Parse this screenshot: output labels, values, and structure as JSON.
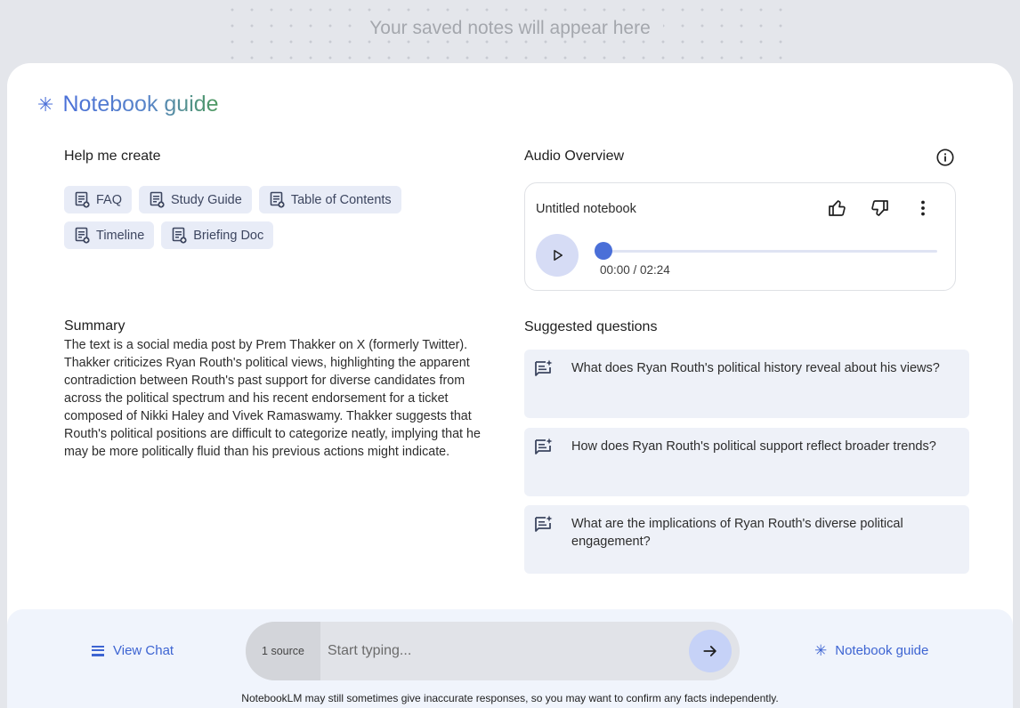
{
  "background": {
    "saved_notes_text": "Your saved notes will appear here"
  },
  "guide": {
    "title": "Notebook guide",
    "help_heading": "Help me create",
    "chips_row1": [
      "FAQ",
      "Study Guide",
      "Table of Contents"
    ],
    "chips_row2": [
      "Timeline",
      "Briefing Doc"
    ],
    "summary_heading": "Summary",
    "summary_text": "The text is a social media post by Prem Thakker on X (formerly Twitter). Thakker criticizes Ryan Routh's political views, highlighting the apparent contradiction between Routh's past support for diverse candidates from across the political spectrum and his recent endorsement for a ticket composed of Nikki Haley and Vivek Ramaswamy. Thakker suggests that Routh's political positions are difficult to categorize neatly, implying that he may be more politically fluid than his previous actions might indicate."
  },
  "audio": {
    "heading": "Audio Overview",
    "notebook_title": "Untitled notebook",
    "time_display": "00:00 / 02:24",
    "progress": 0
  },
  "suggested": {
    "heading": "Suggested questions",
    "questions": [
      "What does Ryan Routh's political history reveal about his views?",
      "How does Ryan Routh's political support reflect broader trends?",
      "What are the implications of Ryan Routh's diverse political engagement?"
    ]
  },
  "bottom": {
    "view_chat": "View Chat",
    "source_count": "1 source",
    "input_placeholder": "Start typing...",
    "notebook_guide": "Notebook guide",
    "disclaimer": "NotebookLM may still sometimes give inaccurate responses, so you may want to confirm any facts independently."
  },
  "colors": {
    "accent": "#4a6fd8",
    "chip_bg": "#e8ecf7",
    "question_bg": "#eef1f8"
  },
  "icons": [
    "asterisk-icon",
    "doc-icon",
    "info-icon",
    "thumbs-up-icon",
    "thumbs-down-icon",
    "more-vert-icon",
    "play-icon",
    "note-sparkle-icon",
    "chat-icon",
    "arrow-right-icon"
  ]
}
